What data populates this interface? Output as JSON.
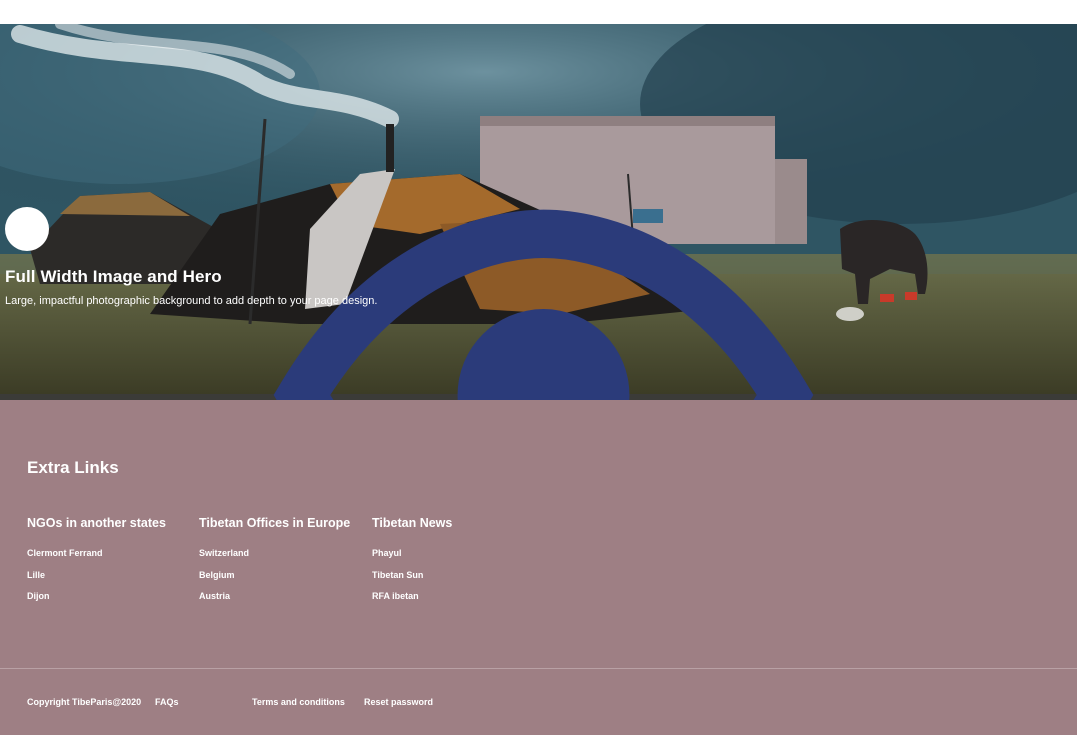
{
  "hero": {
    "title": "Full Width Image and Hero",
    "subtitle": "Large, impactful photographic background to add depth to your page design.",
    "icon": "eye-icon"
  },
  "footer": {
    "heading": "Extra Links",
    "columns": [
      {
        "title": "NGOs in another states",
        "links": [
          "Clermont Ferrand",
          "Lille",
          "Dijon"
        ]
      },
      {
        "title": "Tibetan Offices in Europe",
        "links": [
          "Switzerland",
          "Belgium",
          "Austria"
        ]
      },
      {
        "title": "Tibetan News",
        "links": [
          "Phayul",
          "Tibetan Sun",
          "RFA ibetan"
        ]
      }
    ],
    "copyright": "Copyright TibeParis@2020",
    "faqs": "FAQs",
    "terms": "Terms and conditions",
    "reset": "Reset password",
    "background_color": "#9e7f84"
  }
}
